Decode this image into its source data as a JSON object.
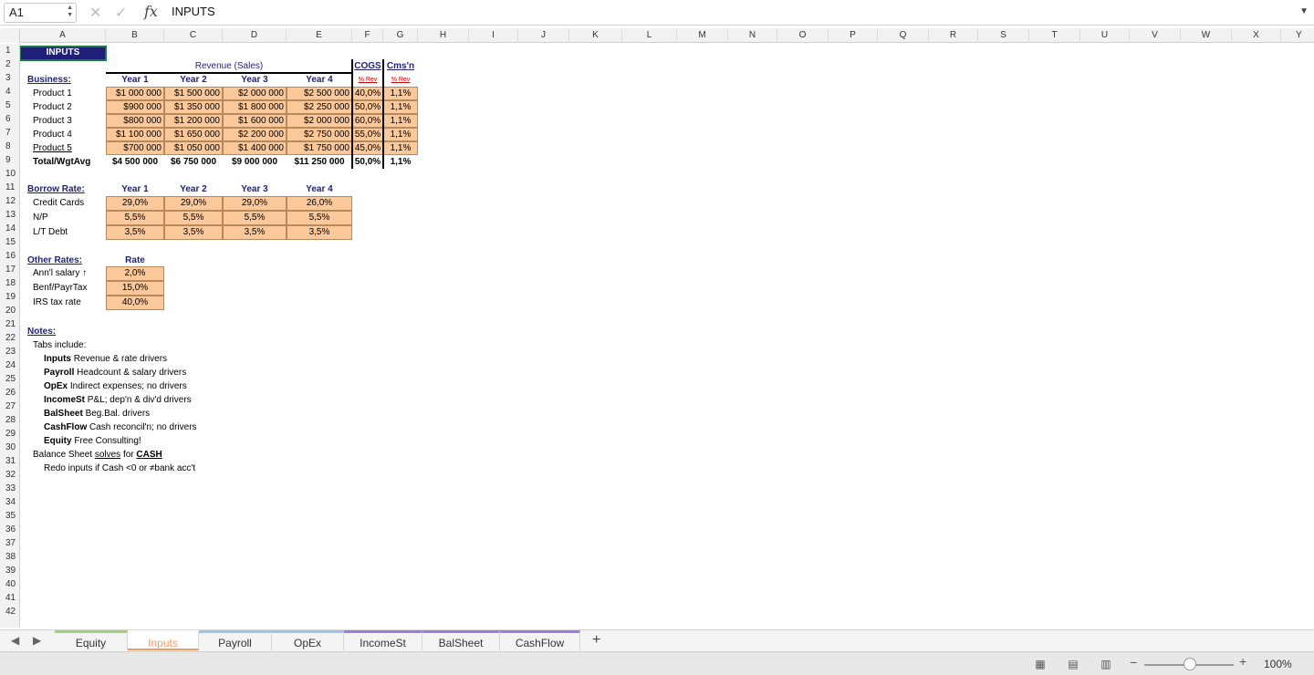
{
  "formula_bar": {
    "name_box": "A1",
    "content": "INPUTS"
  },
  "columns": [
    "A",
    "B",
    "C",
    "D",
    "E",
    "F",
    "G",
    "H",
    "I",
    "J",
    "K",
    "L",
    "M",
    "N",
    "O",
    "P",
    "Q",
    "R",
    "S",
    "T",
    "U",
    "V",
    "W",
    "X",
    "Y"
  ],
  "rows": [
    "1",
    "2",
    "3",
    "4",
    "5",
    "6",
    "7",
    "8",
    "9",
    "10",
    "11",
    "12",
    "13",
    "14",
    "15",
    "16",
    "17",
    "18",
    "19",
    "20",
    "21",
    "22",
    "23",
    "24",
    "25",
    "26",
    "27",
    "28",
    "29",
    "30",
    "31",
    "32",
    "33",
    "34",
    "35",
    "36",
    "37",
    "38",
    "39",
    "40",
    "41",
    "42"
  ],
  "sheet": {
    "title": "INPUTS",
    "revenue_header": "Revenue (Sales)",
    "cogs_header": "COGS",
    "cmsn_header": "Cms'n",
    "pct_rev_a": "% Rev",
    "pct_rev_b": "% Rev",
    "business_label": "Business:",
    "year_headers": [
      "Year 1",
      "Year 2",
      "Year 3",
      "Year 4"
    ],
    "products": [
      {
        "name": "Product 1",
        "y1": "$1 000 000",
        "y2": "$1 500 000",
        "y3": "$2 000 000",
        "y4": "$2 500 000",
        "cogs": "40,0%",
        "cmsn": "1,1%"
      },
      {
        "name": "Product 2",
        "y1": "$900 000",
        "y2": "$1 350 000",
        "y3": "$1 800 000",
        "y4": "$2 250 000",
        "cogs": "50,0%",
        "cmsn": "1,1%"
      },
      {
        "name": "Product 3",
        "y1": "$800 000",
        "y2": "$1 200 000",
        "y3": "$1 600 000",
        "y4": "$2 000 000",
        "cogs": "60,0%",
        "cmsn": "1,1%"
      },
      {
        "name": "Product 4",
        "y1": "$1 100 000",
        "y2": "$1 650 000",
        "y3": "$2 200 000",
        "y4": "$2 750 000",
        "cogs": "55,0%",
        "cmsn": "1,1%"
      },
      {
        "name": "Product 5",
        "y1": "$700 000",
        "y2": "$1 050 000",
        "y3": "$1 400 000",
        "y4": "$1 750 000",
        "cogs": "45,0%",
        "cmsn": "1,1%"
      }
    ],
    "total": {
      "name": "Total/WgtAvg",
      "y1": "$4 500 000",
      "y2": "$6 750 000",
      "y3": "$9 000 000",
      "y4": "$11 250 000",
      "cogs": "50,0%",
      "cmsn": "1,1%"
    },
    "borrow_label": "Borrow Rate:",
    "borrow": [
      {
        "name": "Credit Cards",
        "vals": [
          "29,0%",
          "29,0%",
          "29,0%",
          "26,0%"
        ]
      },
      {
        "name": "N/P",
        "vals": [
          "5,5%",
          "5,5%",
          "5,5%",
          "5,5%"
        ]
      },
      {
        "name": "L/T Debt",
        "vals": [
          "3,5%",
          "3,5%",
          "3,5%",
          "3,5%"
        ]
      }
    ],
    "other_label": "Other Rates:",
    "rate_header": "Rate",
    "other": [
      {
        "name": "Ann'l salary ↑",
        "val": "2,0%"
      },
      {
        "name": "Benf/PayrTax",
        "val": "15,0%"
      },
      {
        "name": "IRS tax rate",
        "val": "40,0%"
      }
    ],
    "notes_label": "Notes:",
    "tabs_include": "Tabs include:",
    "notes": [
      {
        "tab": "Inputs",
        "desc": "Revenue & rate drivers"
      },
      {
        "tab": "Payroll",
        "desc": "Headcount & salary drivers"
      },
      {
        "tab": "OpEx",
        "desc": "Indirect expenses; no drivers"
      },
      {
        "tab": "IncomeSt",
        "desc": "P&L; dep'n & div'd drivers"
      },
      {
        "tab": "BalSheet",
        "desc": "Beg.Bal. drivers"
      },
      {
        "tab": "CashFlow",
        "desc": "Cash reconcil'n; no drivers"
      },
      {
        "tab": "Equity",
        "desc": "Free Consulting!"
      }
    ],
    "bs_a": "Balance Sheet ",
    "bs_b": "solves",
    "bs_c": " for ",
    "bs_d": "CASH",
    "redo": "Redo inputs if Cash <0 or ≠bank acc't"
  },
  "tabs": [
    {
      "label": "Equity",
      "color": "#9fd37a"
    },
    {
      "label": "Inputs",
      "color": "#f29a5e",
      "active": true
    },
    {
      "label": "Payroll",
      "color": "#9cc3e6"
    },
    {
      "label": "OpEx",
      "color": "#9cc3e6"
    },
    {
      "label": "IncomeSt",
      "color": "#9b7fe0"
    },
    {
      "label": "BalSheet",
      "color": "#9b7fe0"
    },
    {
      "label": "CashFlow",
      "color": "#9b7fe0"
    }
  ],
  "zoom": "100%"
}
